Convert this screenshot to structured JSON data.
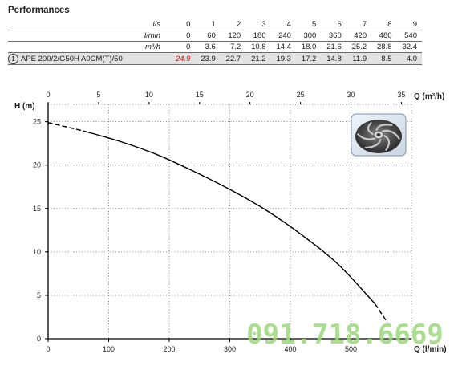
{
  "title": "Performances",
  "table": {
    "units": [
      "l/s",
      "l/min",
      "m³/h"
    ],
    "rows": [
      [
        "0",
        "1",
        "2",
        "3",
        "4",
        "5",
        "6",
        "7",
        "8",
        "9"
      ],
      [
        "0",
        "60",
        "120",
        "180",
        "240",
        "300",
        "360",
        "420",
        "480",
        "540"
      ],
      [
        "0",
        "3.6",
        "7.2",
        "10.8",
        "14.4",
        "18.0",
        "21.6",
        "25.2",
        "28.8",
        "32.4"
      ]
    ],
    "model_num": "1",
    "model": "APE 200/2/G50H A0CM(T)/50",
    "head_values": [
      "24.9",
      "23.9",
      "22.7",
      "21.2",
      "19.3",
      "17.2",
      "14.8",
      "11.9",
      "8.5",
      "4.0"
    ]
  },
  "chart_data": {
    "type": "line",
    "ylabel": "H (m)",
    "xlabel": "Q (l/min)",
    "x2label": "Q (m³/h)",
    "ylim": [
      0,
      27
    ],
    "xlim": [
      0,
      600
    ],
    "x2lim": [
      0,
      36
    ],
    "yticks": [
      0,
      5,
      10,
      15,
      20,
      25
    ],
    "xticks": [
      0,
      100,
      200,
      300,
      400,
      500
    ],
    "x2ticks": [
      0,
      5,
      10,
      15,
      20,
      25,
      30,
      35
    ],
    "grid": true,
    "series": [
      {
        "x": [
          0,
          60,
          120,
          180,
          240,
          300,
          360,
          420,
          480,
          540,
          560
        ],
        "y": [
          24.9,
          23.9,
          22.7,
          21.2,
          19.3,
          17.2,
          14.8,
          11.9,
          8.5,
          4.0,
          1.9
        ]
      }
    ]
  },
  "watermark": "091.718.6669",
  "colors": {
    "curve": "#000000",
    "grid": "#666666",
    "highlight_value": "#d01515",
    "watermark": "#9bd87a",
    "model_row": "#e2e2e2"
  },
  "icons": {
    "impeller": "impeller-photo"
  }
}
